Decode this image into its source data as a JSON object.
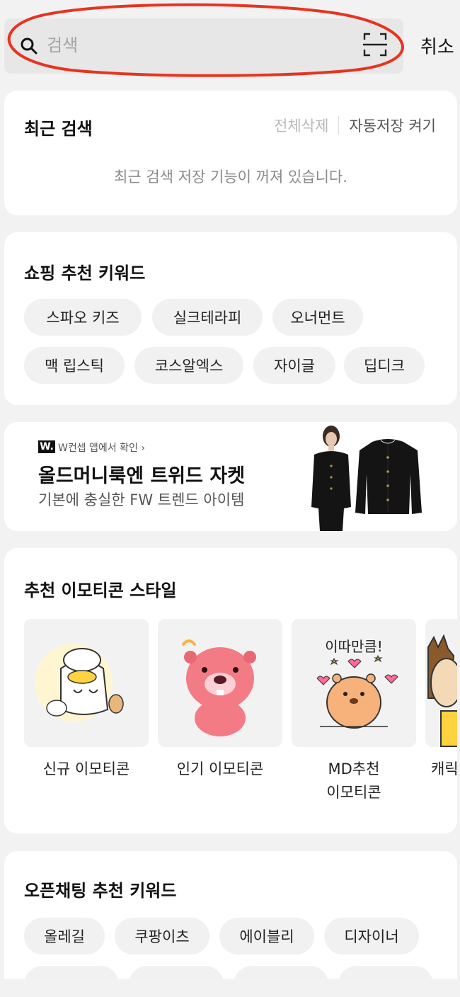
{
  "search": {
    "placeholder": "검색",
    "cancel_label": "취소"
  },
  "recent": {
    "title": "최근 검색",
    "delete_all": "전체삭제",
    "autosave": "자동저장 켜기",
    "message": "최근 검색 저장 기능이 꺼져 있습니다."
  },
  "shopping": {
    "title": "쇼핑 추천 키워드",
    "keywords": [
      "스파오 키즈",
      "실크테라피",
      "오너먼트",
      "맥 립스틱",
      "코스알엑스",
      "자이글",
      "딥디크"
    ]
  },
  "banner": {
    "logo": "W.",
    "subtitle": "W컨셉 앱에서 확인 ›",
    "title": "올드머니룩엔 트위드 자켓",
    "description": "기본에 충실한 FW 트렌드 아이템"
  },
  "emoticon": {
    "title": "추천 이모티콘 스타일",
    "items": [
      {
        "label": "신규 이모티콘"
      },
      {
        "label": "인기 이모티콘"
      },
      {
        "label": "MD추천",
        "label2": "이모티콘"
      },
      {
        "label": "캐릭"
      }
    ],
    "sticker_text": "이따만큼!"
  },
  "openchat": {
    "title": "오픈채팅 추천 키워드",
    "keywords": [
      "올레길",
      "쿠팡이츠",
      "에이블리",
      "디자이너"
    ]
  },
  "colors": {
    "annotation": "#e8331f",
    "background": "#f2f2f2",
    "chip": "#f1f1f1"
  }
}
